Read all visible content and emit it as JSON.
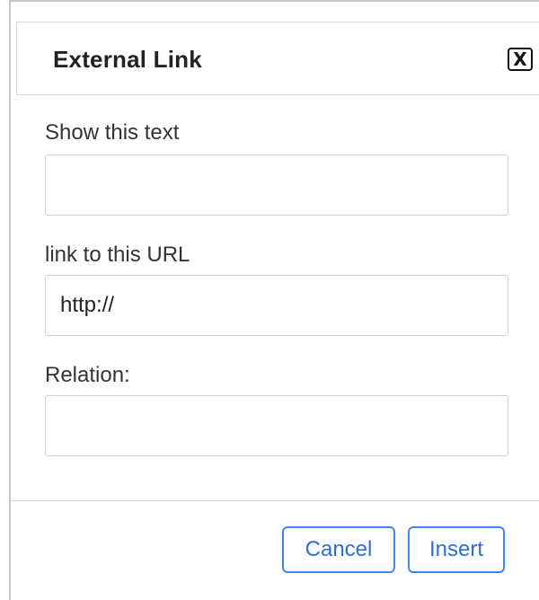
{
  "dialog": {
    "title": "External Link",
    "close_label": "X",
    "close_icon": "close-icon"
  },
  "form": {
    "show_text": {
      "label": "Show this text",
      "value": "",
      "placeholder": ""
    },
    "url": {
      "label": "link to this URL",
      "value": "http://",
      "placeholder": ""
    },
    "relation": {
      "label": "Relation:",
      "value": "",
      "placeholder": ""
    }
  },
  "actions": {
    "cancel_label": "Cancel",
    "insert_label": "Insert"
  },
  "colors": {
    "button_border": "#3d86f5",
    "button_text": "#2a6fdb",
    "field_border": "#cfcfcf",
    "title_text": "#222222"
  }
}
